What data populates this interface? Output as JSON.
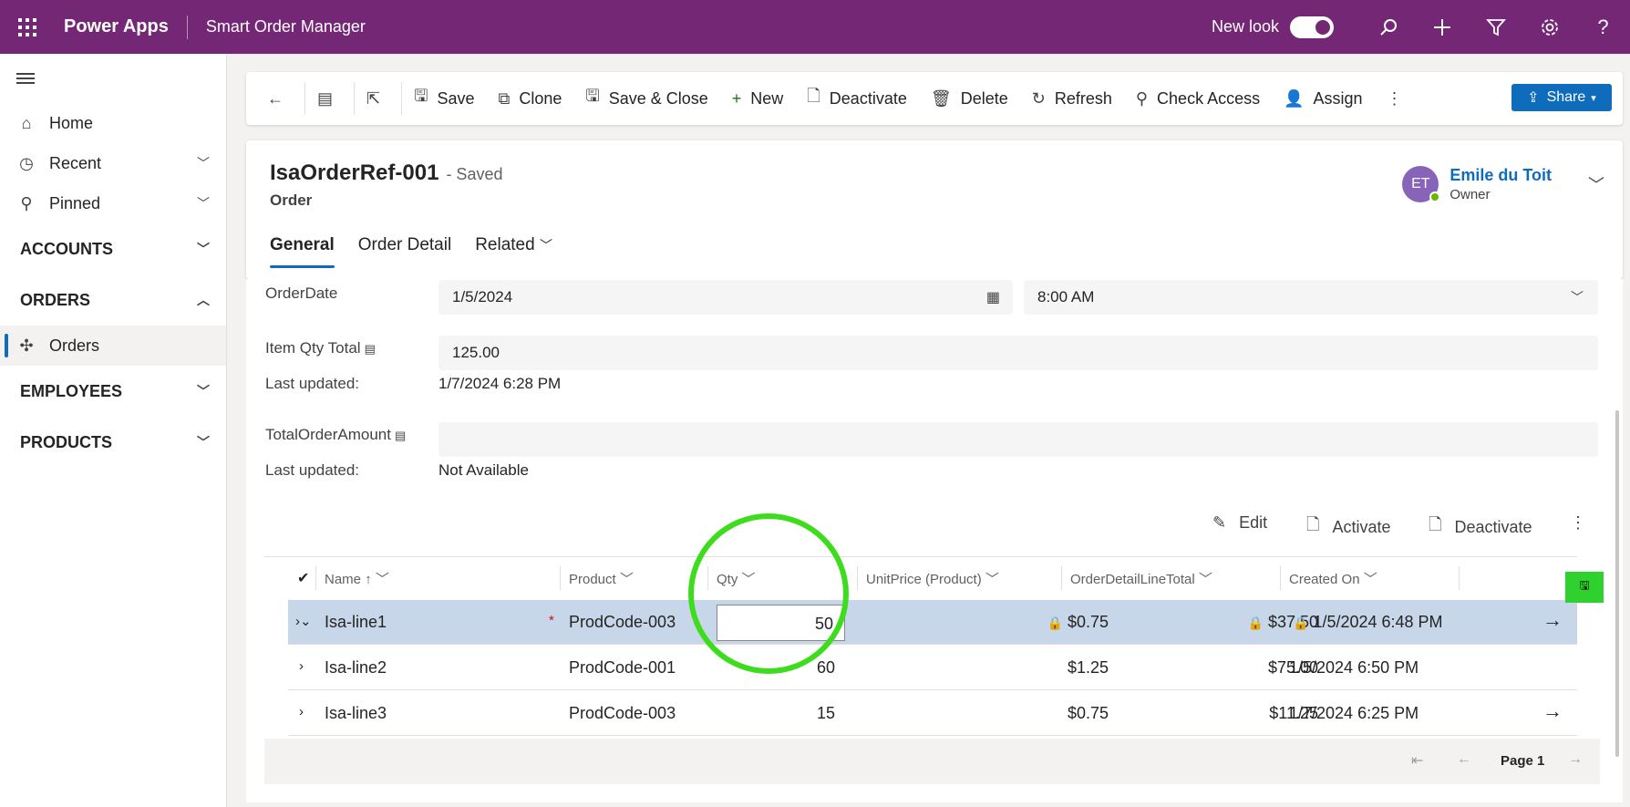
{
  "topbar": {
    "brand": "Power Apps",
    "app_name": "Smart Order Manager",
    "new_look_label": "New look",
    "icons": [
      "search-icon",
      "plus-icon",
      "filter-icon",
      "gear-icon",
      "help-icon"
    ]
  },
  "sidebar": {
    "items": [
      {
        "label": "Home",
        "icon": "home-icon"
      },
      {
        "label": "Recent",
        "icon": "clock-icon"
      },
      {
        "label": "Pinned",
        "icon": "pin-icon"
      }
    ],
    "groups": {
      "accounts": "ACCOUNTS",
      "orders": "ORDERS",
      "orders_item": "Orders",
      "employees": "EMPLOYEES",
      "products": "PRODUCTS"
    }
  },
  "commandbar": {
    "save": "Save",
    "clone": "Clone",
    "save_close": "Save & Close",
    "new": "New",
    "deactivate": "Deactivate",
    "delete": "Delete",
    "refresh": "Refresh",
    "check_access": "Check Access",
    "assign": "Assign",
    "share": "Share"
  },
  "header": {
    "record_name": "IsaOrderRef-001",
    "status": "- Saved",
    "entity": "Order",
    "owner_initials": "ET",
    "owner_name": "Emile du Toit",
    "owner_role": "Owner",
    "tabs": [
      "General",
      "Order Detail",
      "Related"
    ]
  },
  "form": {
    "order_date_label": "OrderDate",
    "order_date": "1/5/2024",
    "order_time": "8:00 AM",
    "item_qty_label": "Item Qty Total",
    "item_qty_value": "125.00",
    "last_updated_label": "Last updated:",
    "item_qty_updated": "1/7/2024 6:28 PM",
    "total_amount_label": "TotalOrderAmount",
    "total_amount_value": "",
    "total_amount_updated": "Not Available"
  },
  "subgrid": {
    "commands": {
      "edit": "Edit",
      "activate": "Activate",
      "deactivate": "Deactivate"
    },
    "columns": {
      "name": "Name",
      "product": "Product",
      "qty": "Qty",
      "unit_price": "UnitPrice (Product)",
      "line_total": "OrderDetailLineTotal",
      "created_on": "Created On"
    },
    "rows": [
      {
        "name": "Isa-line1",
        "product": "ProdCode-003",
        "qty": "50",
        "unit_price": "$0.75",
        "line_total": "$37.50",
        "created_on": "1/5/2024 6:48 PM"
      },
      {
        "name": "Isa-line2",
        "product": "ProdCode-001",
        "qty": "60",
        "unit_price": "$1.25",
        "line_total": "$75.00",
        "created_on": "1/5/2024 6:50 PM"
      },
      {
        "name": "Isa-line3",
        "product": "ProdCode-003",
        "qty": "15",
        "unit_price": "$0.75",
        "line_total": "$11.25",
        "created_on": "1/7/2024 6:25 PM"
      }
    ],
    "pager_label": "Page 1"
  },
  "colors": {
    "topbar": "#742774",
    "accent": "#0f6cbd",
    "selected_row": "#c7d6e8",
    "annotation_green": "#3ddc1d"
  }
}
